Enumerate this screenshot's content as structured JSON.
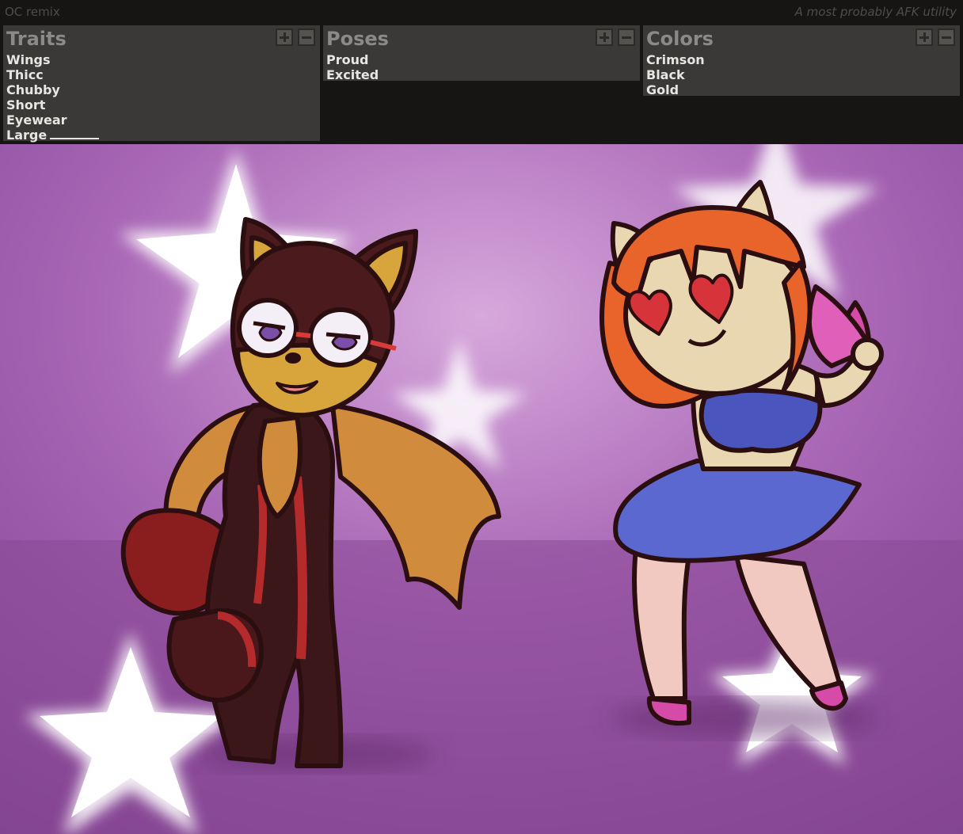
{
  "header": {
    "app_title": "OC remix",
    "tagline": "A most probably AFK utility"
  },
  "panels": [
    {
      "title": "Traits",
      "items": [
        "Wings",
        "Thicc",
        "Chubby",
        "Short",
        "Eyewear",
        "Large"
      ]
    },
    {
      "title": "Poses",
      "items": [
        "Proud",
        "Excited"
      ]
    },
    {
      "title": "Colors",
      "items": [
        "Crimson",
        "Black",
        "Gold"
      ]
    }
  ],
  "colors": {
    "app_background": "#161514",
    "panel_background": "#3a3938",
    "panel_title": "#8b8a88",
    "item_text": "#e8e6e2",
    "scene_background": "#9a5aa6"
  }
}
